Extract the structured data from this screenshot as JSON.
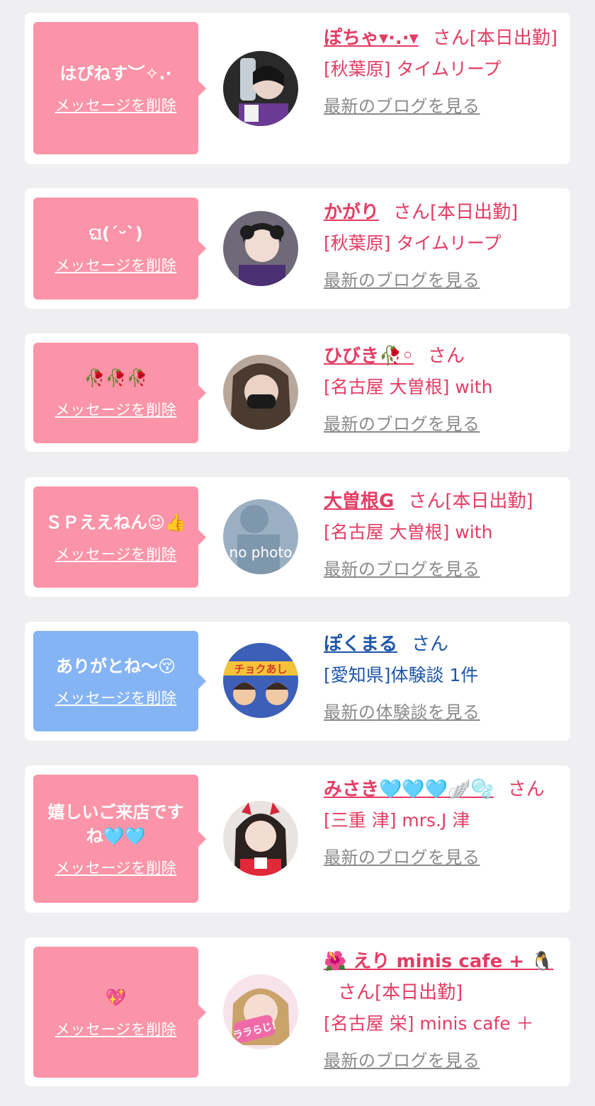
{
  "delete_label": "メッセージを削除",
  "san_label": "さん",
  "items": [
    {
      "message": "はぴねす︶✧.·",
      "name": "ぽちゃ▾·.·▾",
      "status": "[本日出勤]",
      "shop": "[秋葉原] タイムリープ",
      "link": "最新のブログを見る"
    },
    {
      "message": "ଘ(ˊᵕˋ)",
      "name": "かがり",
      "status": "[本日出勤]",
      "shop": "[秋葉原] タイムリープ",
      "link": "最新のブログを見る"
    },
    {
      "message": "🥀🥀🥀",
      "name": "ひびき🥀◦",
      "status": "",
      "shop": "[名古屋 大曽根] with",
      "link": "最新のブログを見る"
    },
    {
      "message": "ＳＰええねん😉👍",
      "name": "大曽根G",
      "status": "[本日出勤]",
      "shop": "[名古屋 大曽根] with",
      "link": "最新のブログを見る"
    },
    {
      "message": "ありがとね〜😚",
      "name": "ぽくまる",
      "status": "",
      "shop": "[愛知県]体験談 1件",
      "link": "最新の体験談を見る"
    },
    {
      "message": "嬉しいご来店ですね🩵🩵",
      "name": "みさき🩵🩵🩵🪽🫧",
      "status": "",
      "shop": "[三重 津] mrs.J 津",
      "link": "最新のブログを見る"
    },
    {
      "message": "💖",
      "name": "🌺 えり minis cafe + 🐧",
      "status": "[本日出勤]",
      "shop": "[名古屋 栄] minis cafe ＋",
      "link": "最新のブログを見る"
    }
  ],
  "avatar_text": "no photo",
  "avatar_sticker_text": "ララらじ!",
  "colors": {
    "pink_bubble": "#fb94a8",
    "blue_bubble": "#85b4f4",
    "pink_text": "#e33c64",
    "blue_text": "#1d56a9"
  }
}
